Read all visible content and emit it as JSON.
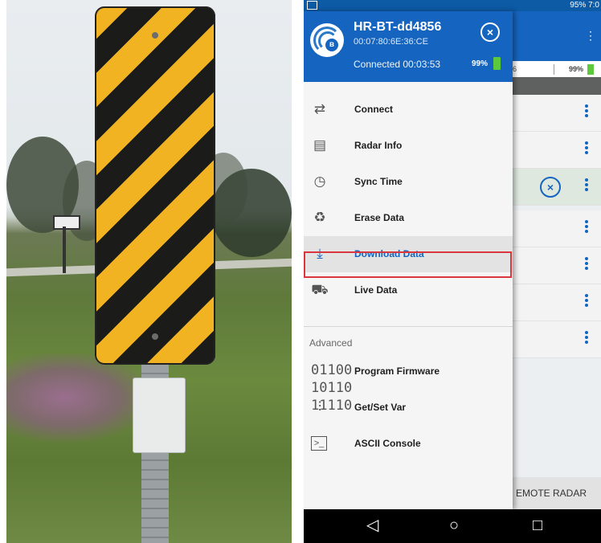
{
  "phone": {
    "status_bar": {
      "right_text": "95% 7:0"
    },
    "drawer": {
      "device_name": "HR-BT-dd4856",
      "device_mac": "00:07:80:6E:36:CE",
      "connection_status": "Connected 00:03:53",
      "battery_percent": "99%",
      "menu_items": [
        {
          "label": "Connect",
          "icon": "swap-arrows-icon"
        },
        {
          "label": "Radar Info",
          "icon": "clipboard-icon"
        },
        {
          "label": "Sync Time",
          "icon": "clock-sync-icon"
        },
        {
          "label": "Erase Data",
          "icon": "recycle-icon"
        },
        {
          "label": "Download Data",
          "icon": "download-icon",
          "highlighted": true
        },
        {
          "label": "Live Data",
          "icon": "car-radar-icon"
        }
      ],
      "section_advanced": "Advanced",
      "advanced_items": [
        {
          "label": "Program Firmware",
          "icon": "binary-icon"
        },
        {
          "label": "Get/Set Var",
          "icon": "sliders-icon"
        },
        {
          "label": "ASCII Console",
          "icon": "console-icon"
        }
      ],
      "binary_glyph": "01100\n10110\n11110"
    },
    "background": {
      "battery_percent": "99%",
      "partial_percent": "6",
      "remote_button": "EMOTE RADAR"
    },
    "navbar": {
      "back": "◁",
      "home": "○",
      "recents": "□"
    }
  },
  "colors": {
    "primary": "#1565c0",
    "highlight_border": "#d9363e",
    "battery": "#5cc93d"
  }
}
